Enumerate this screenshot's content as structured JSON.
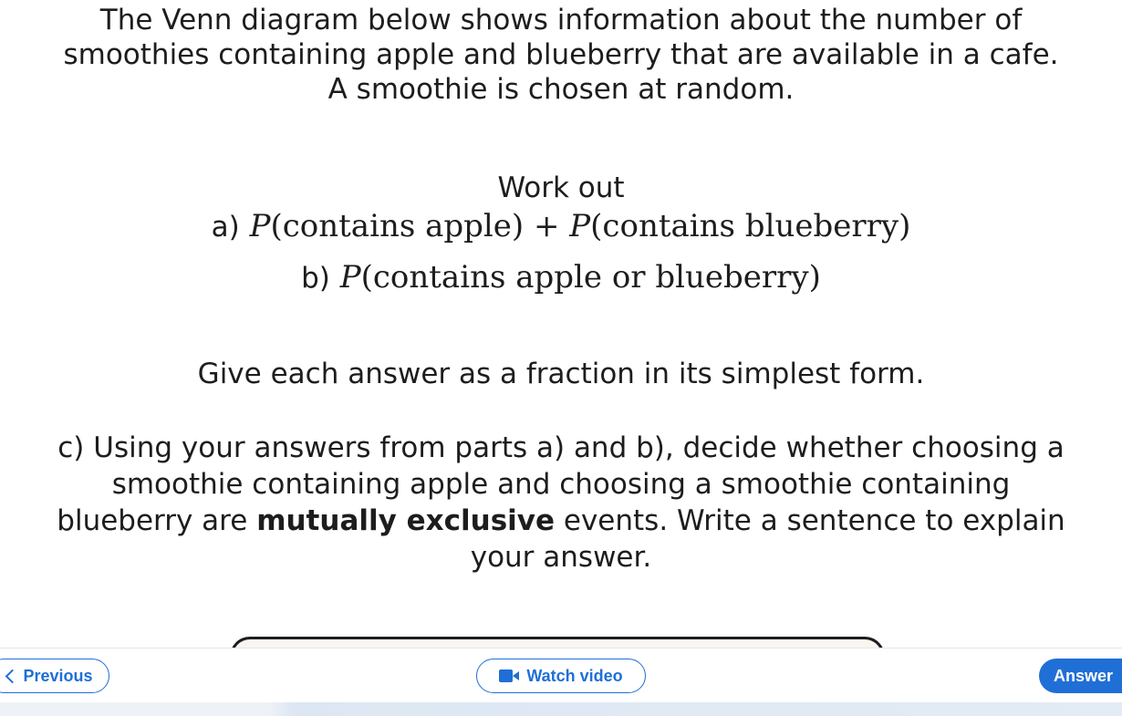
{
  "question": {
    "intro_lines": [
      "The Venn diagram below shows information about the number of",
      "smoothies containing apple and blueberry that are available in a cafe.",
      "A smoothie is chosen at random."
    ],
    "work_out": "Work out",
    "part_a": {
      "label": "a)",
      "p1": "P",
      "t1": "(contains apple) + ",
      "p2": "P",
      "t2": "(contains blueberry)"
    },
    "part_b": {
      "label": "b)",
      "p1": "P",
      "t1": "(contains apple or blueberry)"
    },
    "instruction": "Give each answer as a fraction in its simplest form.",
    "part_c": {
      "line1": "c) Using your answers from parts a) and b), decide whether choosing a",
      "line2": "smoothie containing apple and choosing a smoothie containing",
      "line3_pre": "blueberry are ",
      "line3_bold": "mutually exclusive",
      "line3_post": " events. Write a sentence to explain",
      "line4": "your answer."
    }
  },
  "toolbar": {
    "previous_label": "Previous",
    "video_label": "Watch video",
    "answer_label": "Answer"
  },
  "colors": {
    "accent": "#1f6fd6",
    "text": "#1d1d1f",
    "venn_fill": "#f8f6ef"
  },
  "icons": {
    "previous": "chevron-left-icon",
    "video": "video-camera-icon"
  }
}
